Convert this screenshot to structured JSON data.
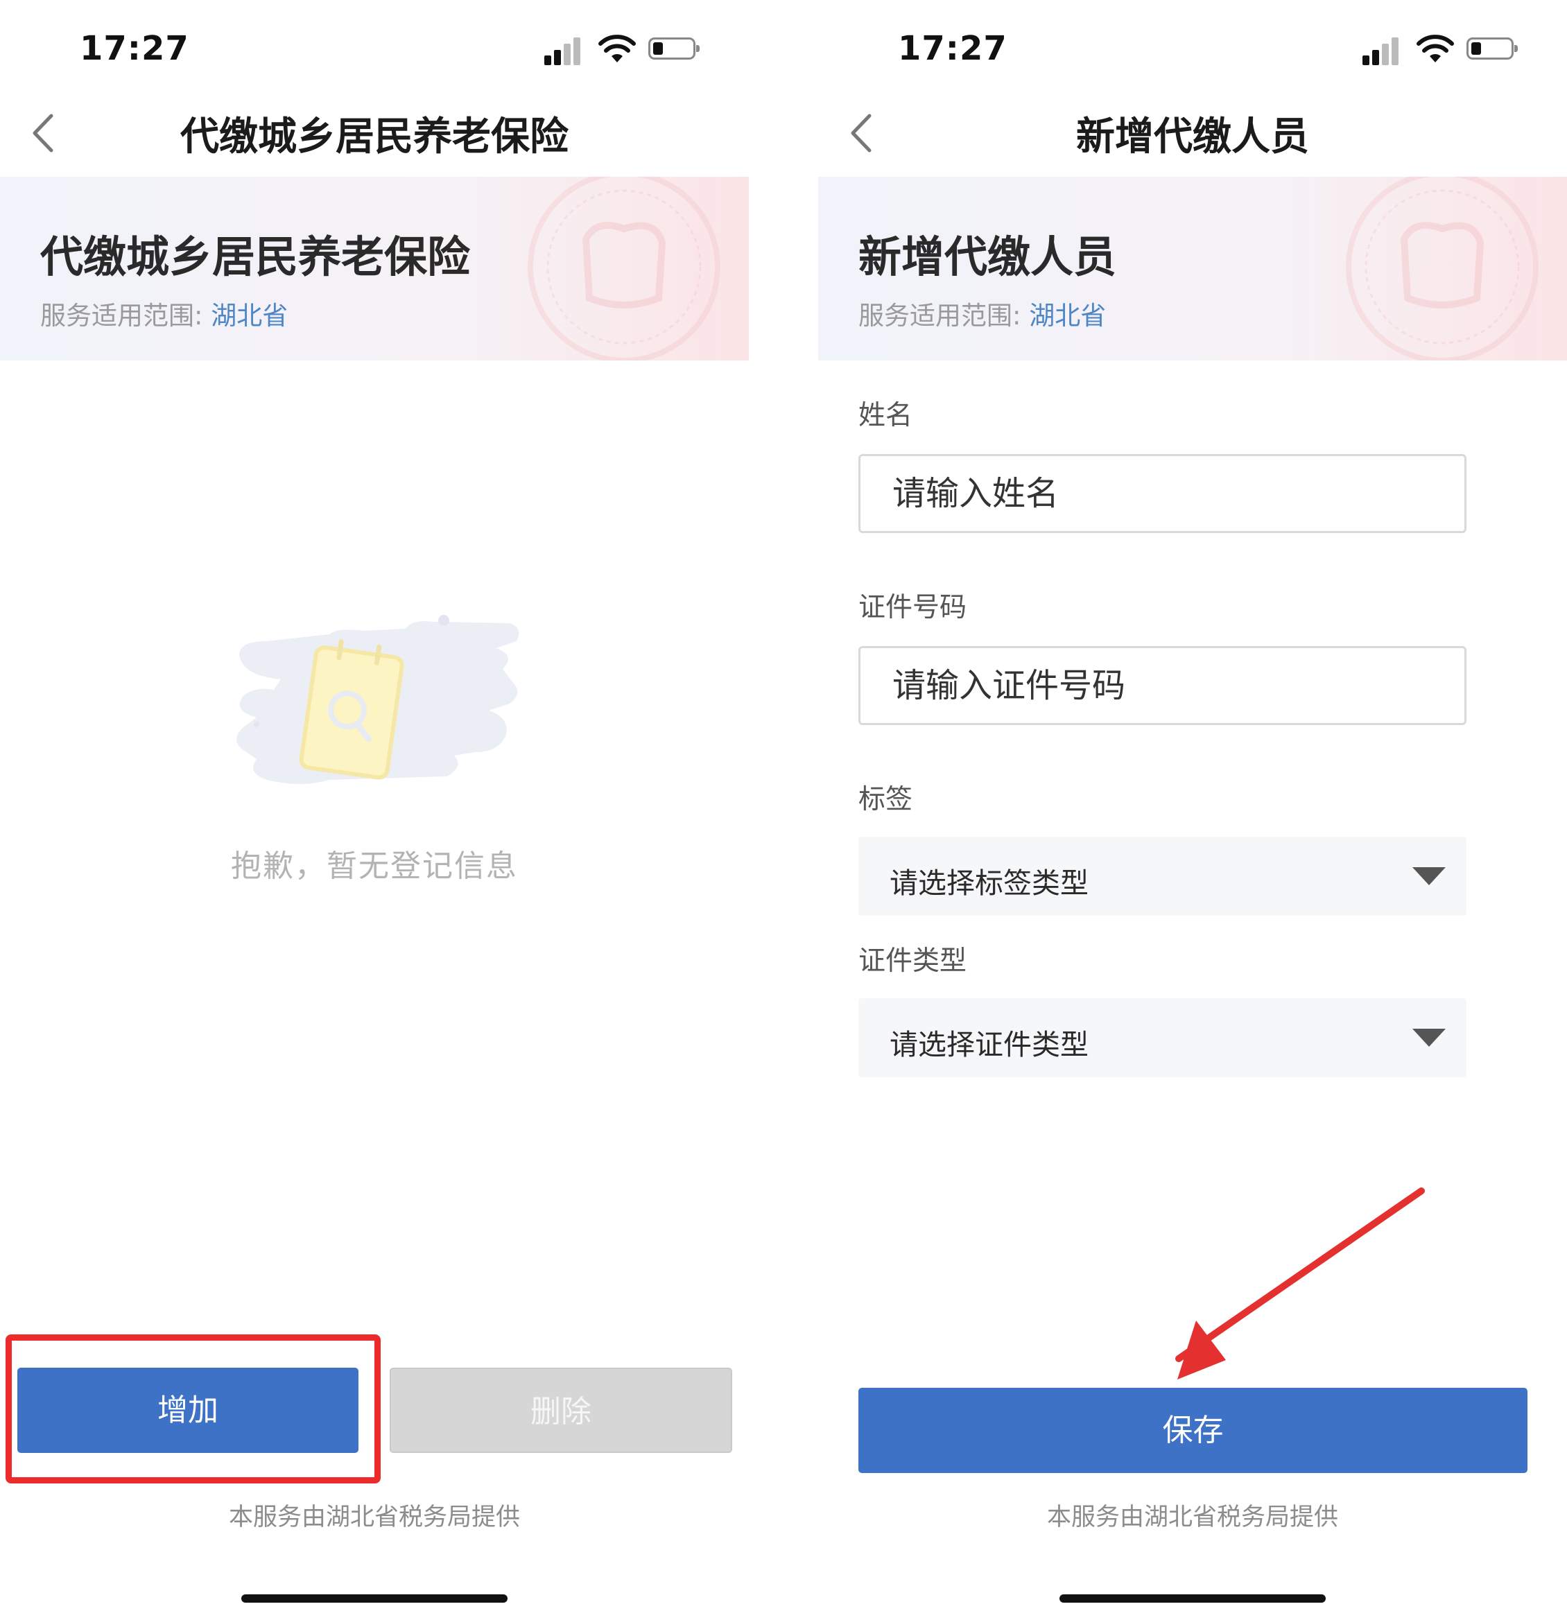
{
  "status_bar": {
    "time": "17:27"
  },
  "left_screen": {
    "nav_title": "代缴城乡居民养老保险",
    "banner": {
      "title": "代缴城乡居民养老保险",
      "scope_label": "服务适用范围:",
      "scope_value": "湖北省"
    },
    "empty_text": "抱歉，暂无登记信息",
    "buttons": {
      "add": "增加",
      "delete": "删除"
    },
    "footer": "本服务由湖北省税务局提供"
  },
  "right_screen": {
    "nav_title": "新增代缴人员",
    "banner": {
      "title": "新增代缴人员",
      "scope_label": "服务适用范围:",
      "scope_value": "湖北省"
    },
    "form": {
      "name": {
        "label": "姓名",
        "placeholder": "请输入姓名"
      },
      "id_number": {
        "label": "证件号码",
        "placeholder": "请输入证件号码"
      },
      "tag": {
        "label": "标签",
        "selected": "请选择标签类型"
      },
      "id_type": {
        "label": "证件类型",
        "selected": "请选择证件类型"
      }
    },
    "save_button": "保存",
    "footer": "本服务由湖北省税务局提供"
  },
  "colors": {
    "primary": "#3d72c6",
    "annotation": "#ee2b2b",
    "scope": "#4f86c6",
    "disabled": "#d6d6d6"
  },
  "icons": [
    "back-icon",
    "signal-icon",
    "wifi-icon",
    "battery-icon",
    "seal-icon",
    "empty-notepad-icon",
    "chevron-down-icon",
    "red-arrow"
  ]
}
